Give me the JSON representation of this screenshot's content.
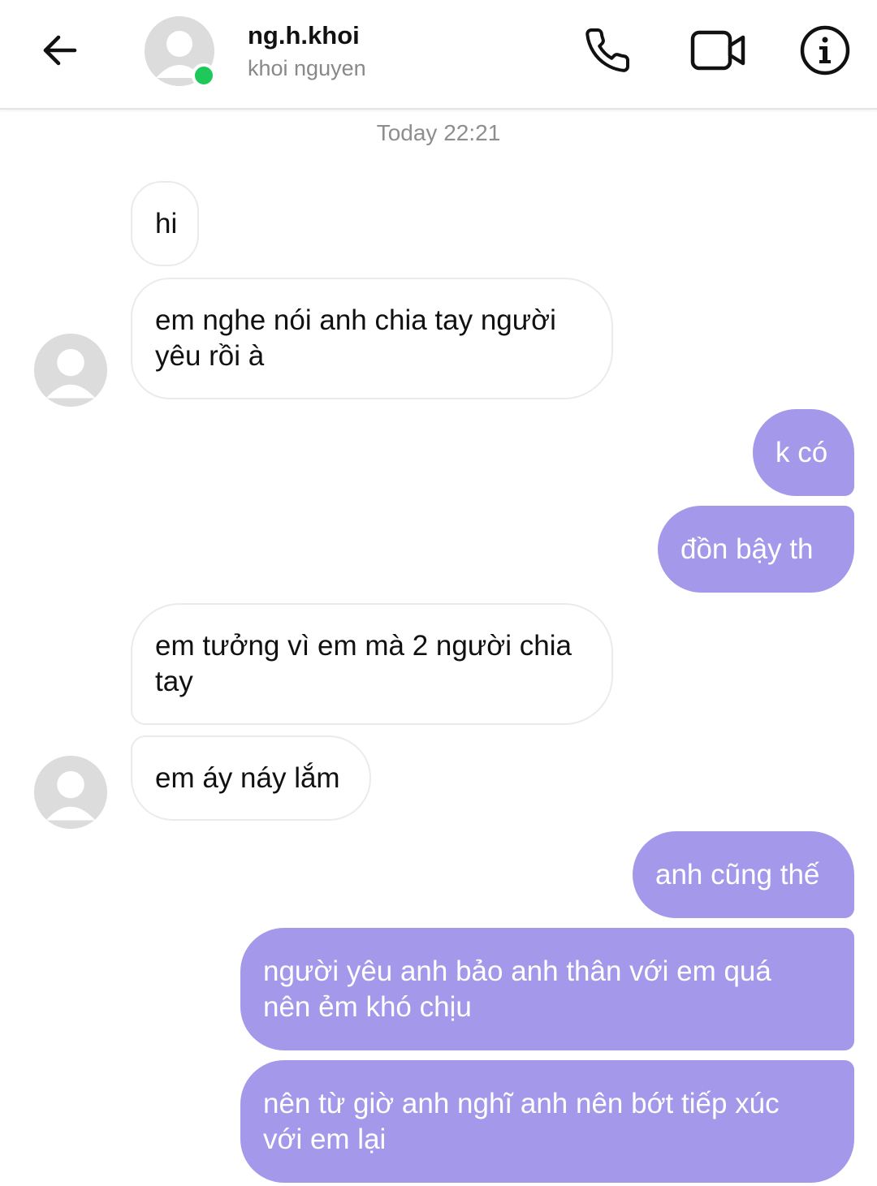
{
  "header": {
    "username": "ng.h.khoi",
    "full_name": "khoi nguyen",
    "online": true,
    "back_icon": "arrow-left-icon",
    "call_icon": "phone-icon",
    "video_icon": "video-camera-icon",
    "info_icon": "info-icon"
  },
  "thread": {
    "timestamp": "Today 22:21"
  },
  "messages": [
    {
      "sender": "them",
      "text": "hi"
    },
    {
      "sender": "them",
      "text": "em nghe nói anh chia tay người\nyêu rồi à"
    },
    {
      "sender": "me",
      "text": "k có"
    },
    {
      "sender": "me",
      "text": "đồn bậy th"
    },
    {
      "sender": "them",
      "text": "em tưởng vì em mà 2 người chia\ntay"
    },
    {
      "sender": "them",
      "text": "em áy náy lắm"
    },
    {
      "sender": "me",
      "text": "anh cũng thế"
    },
    {
      "sender": "me",
      "text": "người yêu anh bảo anh thân với em quá\nnên ẻm khó chịu"
    },
    {
      "sender": "me",
      "text": "nên từ giờ anh nghĩ anh nên bớt tiếp xúc\nvới em lại"
    }
  ],
  "colors": {
    "outgoing_bubble": "#a398ea",
    "incoming_border": "#ebebeb",
    "online_dot": "#1fc85a",
    "timestamp": "#8e8e8e"
  }
}
